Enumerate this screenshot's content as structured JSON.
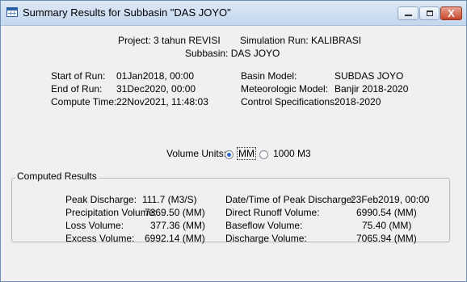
{
  "window": {
    "title": "Summary Results for Subbasin \"DAS JOYO\"",
    "buttons": {
      "close_glyph": "X"
    }
  },
  "header": {
    "project_label": "Project: 3 tahun REVISI",
    "simulation_run_label": "Simulation Run: KALIBRASI",
    "subbasin_label": "Subbasin: DAS JOYO"
  },
  "run_info": {
    "start_label": "Start of Run:",
    "start_value": "01Jan2018, 00:00",
    "end_label": "End of Run:",
    "end_value": "31Dec2020, 00:00",
    "compute_label": "Compute Time:",
    "compute_value": "22Nov2021, 11:48:03",
    "basin_label": "Basin Model:",
    "basin_value": "SUBDAS JOYO",
    "met_label": "Meteorologic Model:",
    "met_value": "Banjir 2018-2020",
    "control_label": "Control Specifications:",
    "control_value": "2018-2020"
  },
  "volume_units": {
    "label": "Volume Units:",
    "options": [
      "MM",
      "1000 M3"
    ],
    "selected": "MM"
  },
  "computed_results": {
    "group_label": "Computed Results",
    "peak_discharge_label": "Peak Discharge:",
    "peak_discharge_value": "111.7 (M3/S)",
    "precip_label": "Precipitation Volume:",
    "precip_value": "7369.50 (MM)",
    "loss_label": "Loss Volume:",
    "loss_value": "377.36 (MM)",
    "excess_label": "Excess Volume:",
    "excess_value": "6992.14 (MM)",
    "peak_time_label": "Date/Time of Peak Discharge:",
    "peak_time_value": "23Feb2019, 00:00",
    "direct_runoff_label": "Direct Runoff Volume:",
    "direct_runoff_value": "6990.54 (MM)",
    "baseflow_label": "Baseflow Volume:",
    "baseflow_value": "75.40 (MM)",
    "discharge_vol_label": "Discharge Volume:",
    "discharge_vol_value": "7065.94 (MM)"
  }
}
